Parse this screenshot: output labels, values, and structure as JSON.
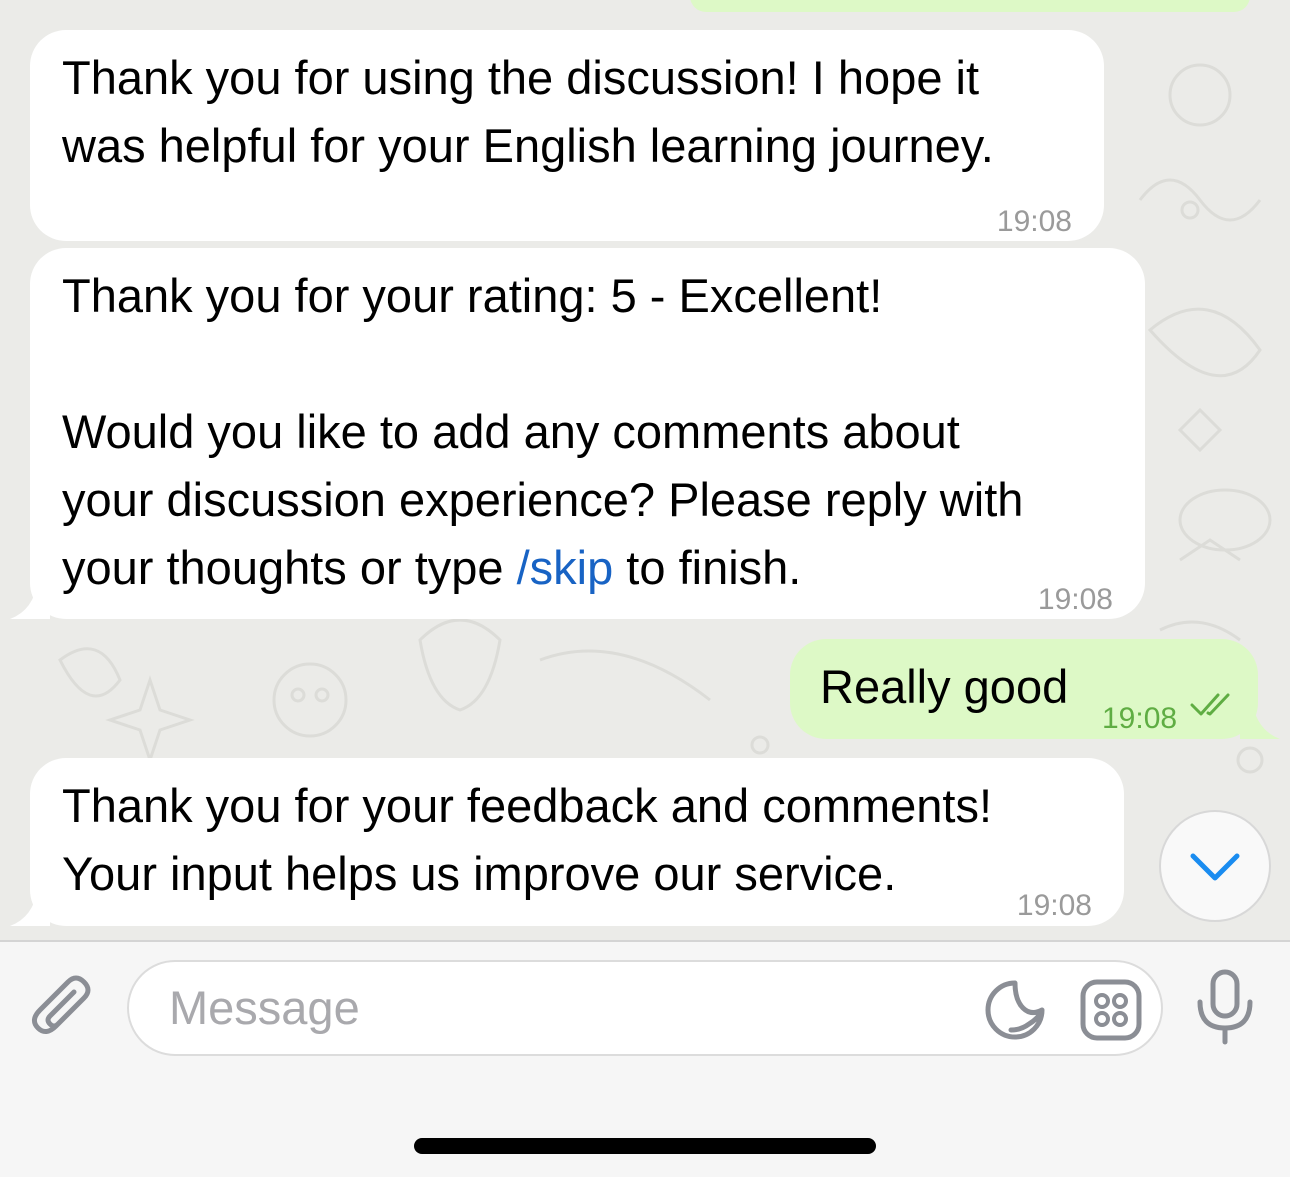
{
  "messages": [
    {
      "direction": "incoming",
      "lines": [
        "Thank you for using the discussion! I hope it",
        "was helpful for your English learning journey."
      ],
      "time": "19:08"
    },
    {
      "direction": "incoming",
      "line1": "Thank you for your rating: 5 - Excellent!",
      "line2": "Would you like to add any comments about",
      "line3": "your discussion experience? Please reply with",
      "line4_before": "your thoughts or type ",
      "line4_link": "/skip",
      "line4_after": " to finish.",
      "time": "19:08"
    },
    {
      "direction": "outgoing",
      "text": "Really good",
      "time": "19:08",
      "status": "read-double-check-icon"
    },
    {
      "direction": "incoming",
      "lines": [
        "Thank you for your feedback and comments!",
        "Your input helps us improve our service."
      ],
      "time": "19:08"
    }
  ],
  "composer": {
    "placeholder": "Message"
  },
  "colors": {
    "incoming_bg": "#ffffff",
    "outgoing_bg": "#ddf9c6",
    "link": "#1863c4",
    "accent": "#1a8cf0",
    "outgoing_time": "#5fad43"
  },
  "icons": [
    "attach-paperclip-icon",
    "sticker-icon",
    "emoji-keyboard-icon",
    "microphone-icon",
    "chevron-down-icon"
  ]
}
